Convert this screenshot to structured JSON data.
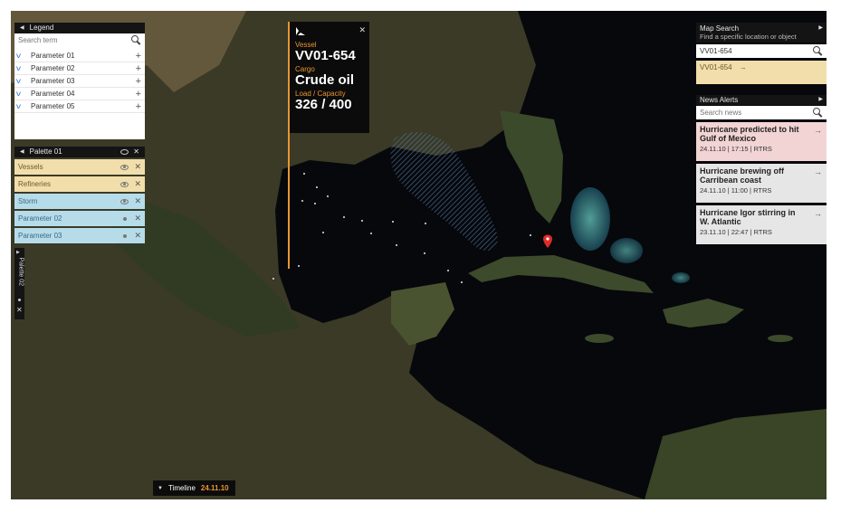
{
  "legend": {
    "title": "Legend",
    "search_placeholder": "Search term",
    "items": [
      {
        "label": "Parameter 01"
      },
      {
        "label": "Parameter 02"
      },
      {
        "label": "Parameter 03"
      },
      {
        "label": "Parameter 04"
      },
      {
        "label": "Parameter 05"
      }
    ]
  },
  "palette01": {
    "title": "Palette 01",
    "layers": [
      {
        "label": "Vessels",
        "color": "yellow",
        "icon": "eye-icon"
      },
      {
        "label": "Refineries",
        "color": "yellow",
        "icon": "eye-icon"
      },
      {
        "label": "Storm",
        "color": "blue",
        "icon": "eye-icon"
      },
      {
        "label": "Parameter 02",
        "color": "blue",
        "icon": "dot-icon"
      },
      {
        "label": "Parameter 03",
        "color": "blue",
        "icon": "dot-icon"
      }
    ]
  },
  "palette02": {
    "title": "Palette 02"
  },
  "vessel": {
    "vessel_label": "Vessel",
    "vessel_value": "VV01-654",
    "cargo_label": "Cargo",
    "cargo_value": "Crude oil",
    "load_label": "Load / Capacity",
    "load_value": "326 / 400"
  },
  "map_search": {
    "title": "Map Search",
    "subtitle": "Find a specific location or object",
    "query": "VV01-654",
    "result": "VV01-654"
  },
  "news": {
    "title": "News Alerts",
    "search_placeholder": "Search news",
    "items": [
      {
        "headline": "Hurricane predicted to hit Gulf of Mexico",
        "meta": "24.11.10 | 17:15 | RTRS",
        "highlight": true
      },
      {
        "headline": "Hurricane brewing off Carribean coast",
        "meta": "24.11.10 | 11:00 | RTRS",
        "highlight": false
      },
      {
        "headline": "Hurricane Igor stirring in W. Atlantic",
        "meta": "23.11.10 | 22:47 | RTRS",
        "highlight": false
      }
    ]
  },
  "timeline": {
    "label": "Timeline",
    "date": "24.11.10"
  },
  "colors": {
    "accent": "#e8962f",
    "yellow_layer": "#f1deab",
    "blue_layer": "#b6dcea",
    "alert_pink": "#f2d4d4",
    "marker_red": "#e02a2a"
  }
}
